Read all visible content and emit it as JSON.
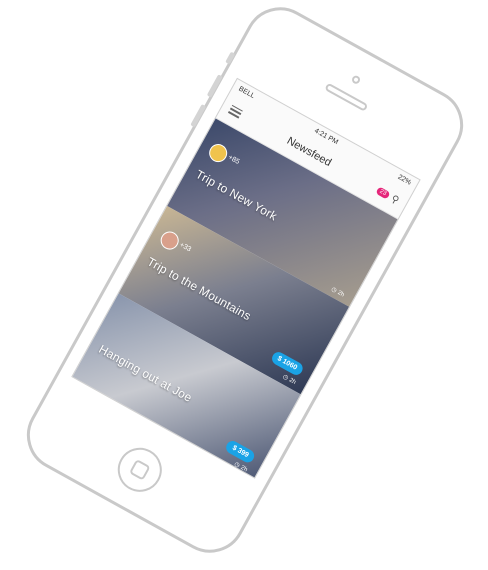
{
  "status": {
    "carrier": "BELL",
    "time": "4:21 PM",
    "battery": "22%"
  },
  "nav": {
    "title": "Newsfeed",
    "badge": "23"
  },
  "cards": [
    {
      "title": "Trip to New York",
      "plus": "+85",
      "time": "2h",
      "price": ""
    },
    {
      "title": "Trip to the Mountains",
      "plus": "+33",
      "time": "2h",
      "price": "$ 1060"
    },
    {
      "title": "Hanging out at Joe",
      "plus": "",
      "time": "2h",
      "price": "$ 399"
    }
  ],
  "colors": {
    "accent_badge": "#e5267a",
    "price_pill": "#1aa3e6"
  }
}
